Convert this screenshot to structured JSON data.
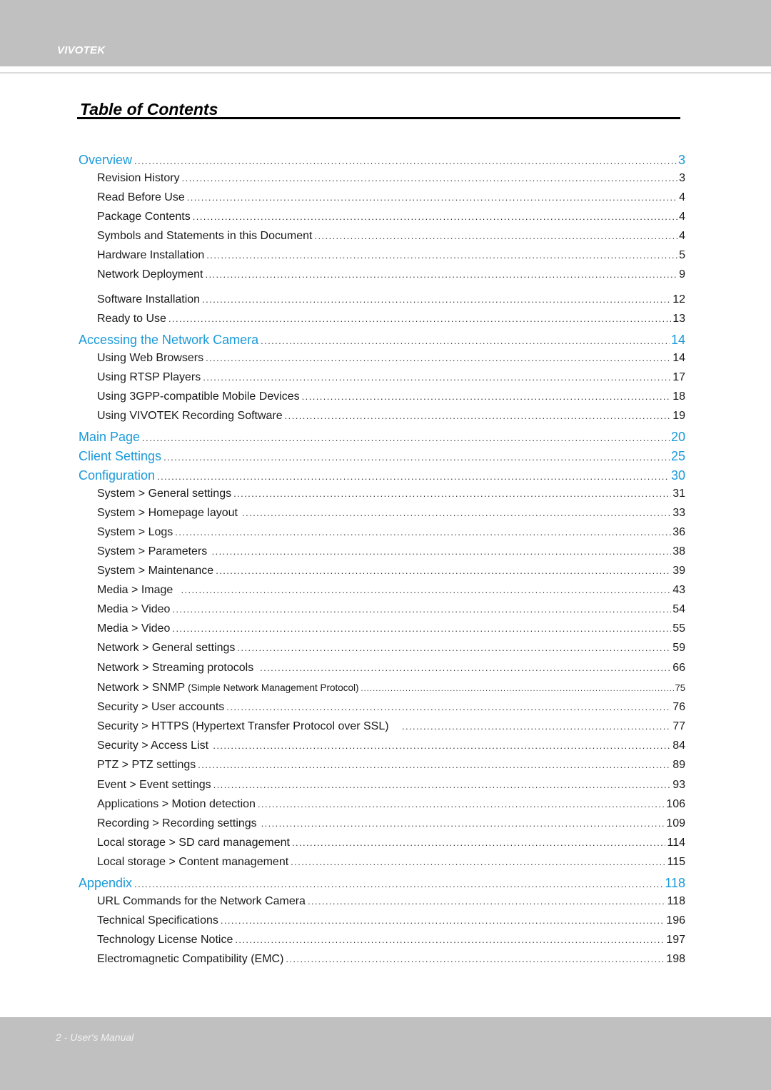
{
  "header": {
    "brand": "VIVOTEK"
  },
  "title": "Table of Contents",
  "toc": [
    {
      "level": "section",
      "label": "Overview",
      "page": "3"
    },
    {
      "level": "sub",
      "label": "Revision History",
      "page": "3"
    },
    {
      "level": "sub",
      "label": "Read Before Use",
      "page": "4"
    },
    {
      "level": "sub",
      "label": "Package Contents",
      "page": "4"
    },
    {
      "level": "sub",
      "label": "Symbols and Statements in this Document",
      "page": "4"
    },
    {
      "level": "sub",
      "label": "Hardware Installation",
      "page": "5"
    },
    {
      "level": "sub",
      "label": "Network Deployment",
      "page": "9"
    },
    {
      "level": "sub",
      "label": "Software Installation",
      "page": "12"
    },
    {
      "level": "sub",
      "label": "Ready to Use",
      "page": "13"
    },
    {
      "level": "section",
      "label": "Accessing the Network Camera",
      "page": "14"
    },
    {
      "level": "sub",
      "label": "Using Web Browsers",
      "page": "14"
    },
    {
      "level": "sub",
      "label": "Using RTSP Players",
      "page": "17"
    },
    {
      "level": "sub",
      "label": "Using 3GPP-compatible Mobile Devices",
      "page": "18"
    },
    {
      "level": "sub",
      "label": "Using VIVOTEK Recording Software",
      "page": "19"
    },
    {
      "level": "section",
      "label": "Main Page",
      "page": "20"
    },
    {
      "level": "section",
      "label": "Client Settings",
      "page": "25"
    },
    {
      "level": "section",
      "label": "Configuration",
      "page": "30"
    },
    {
      "level": "sub",
      "label": "System > General settings",
      "page": "31"
    },
    {
      "level": "sub",
      "label": "System > Homepage layout",
      "page": "33"
    },
    {
      "level": "sub",
      "label": "System > Logs",
      "page": "36"
    },
    {
      "level": "sub",
      "label": "System > Parameters",
      "page": "38"
    },
    {
      "level": "sub",
      "label": "System > Maintenance",
      "page": "39"
    },
    {
      "level": "sub",
      "label": "Media > Image",
      "page": "43"
    },
    {
      "level": "sub",
      "label": "Media > Video",
      "page": "54"
    },
    {
      "level": "sub",
      "label": "Media > Video",
      "page": "55"
    },
    {
      "level": "sub",
      "label": "Network > General settings",
      "page": "59"
    },
    {
      "level": "sub",
      "label": "Network > Streaming protocols",
      "page": "66"
    },
    {
      "level": "sub",
      "label": "Network > SNMP",
      "label_suffix": "(Simple Network Management Protocol)",
      "page": "75"
    },
    {
      "level": "sub",
      "label": "Security > User accounts",
      "page": "76"
    },
    {
      "level": "sub",
      "label": "Security >  HTTPS (Hypertext Transfer Protocol over SSL)",
      "page": "77"
    },
    {
      "level": "sub",
      "label": "Security >  Access List",
      "page": "84"
    },
    {
      "level": "sub",
      "label": "PTZ > PTZ settings",
      "page": "89"
    },
    {
      "level": "sub",
      "label": "Event > Event settings",
      "page": "93"
    },
    {
      "level": "sub",
      "label": "Applications > Motion detection",
      "page": "106"
    },
    {
      "level": "sub",
      "label": "Recording > Recording settings",
      "page": "109"
    },
    {
      "level": "sub",
      "label": "Local storage > SD card management",
      "page": "114"
    },
    {
      "level": "sub",
      "label": "Local storage > Content management",
      "page": "115"
    },
    {
      "level": "section",
      "label": "Appendix",
      "page": "118"
    },
    {
      "level": "sub",
      "label": "URL Commands for the Network Camera",
      "page": "118"
    },
    {
      "level": "sub",
      "label": "Technical Specifications",
      "page": "196"
    },
    {
      "level": "sub",
      "label": "Technology License Notice",
      "page": "197"
    },
    {
      "level": "sub",
      "label": "Electromagnetic Compatibility (EMC)",
      "page": "198"
    }
  ],
  "footer": {
    "text": "2 - User's Manual"
  },
  "colors": {
    "section": "#1a9ad9",
    "band": "#bfc0bf"
  }
}
